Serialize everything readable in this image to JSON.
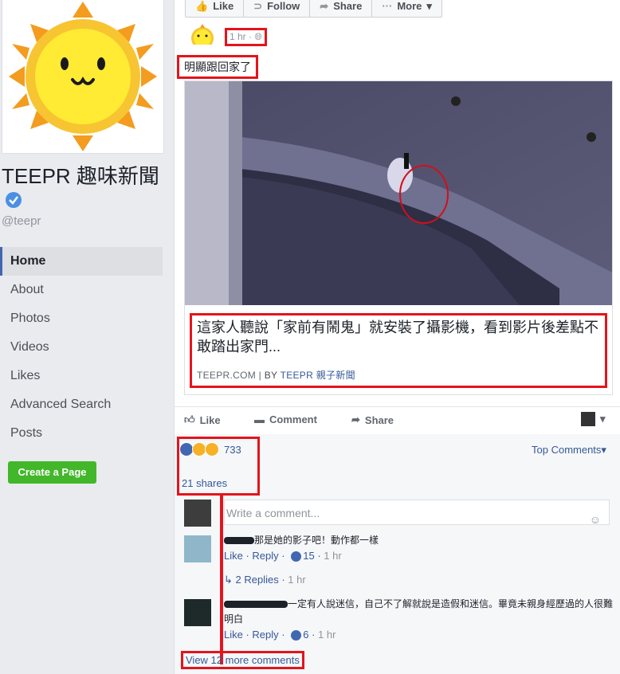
{
  "sidebar": {
    "page_name": "TEEPR 趣味新聞",
    "handle": "@teepr",
    "nav": [
      {
        "label": "Home",
        "active": true
      },
      {
        "label": "About"
      },
      {
        "label": "Photos"
      },
      {
        "label": "Videos"
      },
      {
        "label": "Likes"
      },
      {
        "label": "Advanced Search"
      },
      {
        "label": "Posts"
      }
    ],
    "create_page": "Create a Page"
  },
  "topbar": {
    "like": "Like",
    "follow": "Follow",
    "share": "Share",
    "more": "More"
  },
  "post": {
    "timestamp": "1 hr",
    "text": "明顯跟回家了",
    "link": {
      "title": "這家人聽說「家前有鬧鬼」就安裝了攝影機，看到影片後差點不敢踏出家門...",
      "domain": "TEEPR.COM",
      "by_prefix": "BY",
      "author": "TEEPR 親子新聞"
    },
    "actions": {
      "like": "Like",
      "comment": "Comment",
      "share": "Share"
    },
    "reactions": {
      "count": "733",
      "types": [
        "like-icon",
        "wow-icon",
        "haha-icon"
      ]
    },
    "shares": "21 shares",
    "top_comments": "Top Comments"
  },
  "comments_area": {
    "placeholder": "Write a comment...",
    "comments": [
      {
        "text": "那是她的影子吧！動作都一樣",
        "like": "Like",
        "reply": "Reply",
        "likes": "15",
        "time": "1 hr",
        "replies": "2 Replies",
        "replies_time": "1 hr"
      },
      {
        "text": "一定有人說迷信，自己不了解就說是造假和迷信。畢竟未親身經歷過的人很難明白",
        "like": "Like",
        "reply": "Reply",
        "likes": "6",
        "time": "1 hr"
      }
    ],
    "view_more": "View 12 more comments"
  },
  "colors": {
    "highlight": "#e4141c",
    "link": "#365899",
    "button_green": "#42b72a"
  }
}
